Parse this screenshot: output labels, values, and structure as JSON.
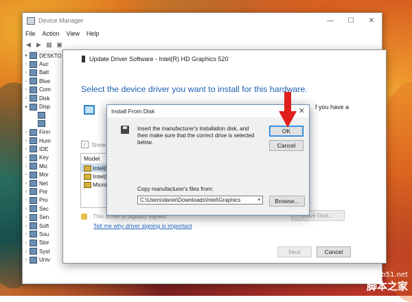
{
  "device_manager": {
    "title": "Device Manager",
    "menu": [
      "File",
      "Action",
      "View",
      "Help"
    ],
    "tree_items": [
      {
        "label": "DESKTO",
        "expanded": true,
        "depth": 0
      },
      {
        "label": "Auc",
        "depth": 1
      },
      {
        "label": "Batt",
        "depth": 1
      },
      {
        "label": "Blue",
        "depth": 1
      },
      {
        "label": "Com",
        "depth": 1
      },
      {
        "label": "Disk",
        "depth": 1
      },
      {
        "label": "Disp",
        "expanded": true,
        "depth": 1
      },
      {
        "label": "",
        "depth": 2
      },
      {
        "label": "",
        "depth": 2
      },
      {
        "label": "Firm",
        "depth": 1
      },
      {
        "label": "Hum",
        "depth": 1
      },
      {
        "label": "IDE",
        "depth": 1
      },
      {
        "label": "Key",
        "depth": 1
      },
      {
        "label": "Mic",
        "depth": 1
      },
      {
        "label": "Mor",
        "depth": 1
      },
      {
        "label": "Net",
        "depth": 1
      },
      {
        "label": "Prir",
        "depth": 1
      },
      {
        "label": "Pro",
        "depth": 1
      },
      {
        "label": "Sec",
        "depth": 1
      },
      {
        "label": "Sen",
        "depth": 1
      },
      {
        "label": "Soft",
        "depth": 1
      },
      {
        "label": "Sou",
        "depth": 1
      },
      {
        "label": "Stor",
        "depth": 1
      },
      {
        "label": "Syst",
        "depth": 1
      },
      {
        "label": "Univ",
        "depth": 1
      }
    ]
  },
  "wizard": {
    "title": "Update Driver Software - Intel(R) HD Graphics 520",
    "heading": "Select the device driver you want to install for this hardware.",
    "side_text": "f you have a",
    "show_compatible": "Show c",
    "model_header": "Model",
    "models": [
      "Intel(R",
      "Intel(R",
      "Micro"
    ],
    "signing_status": "This driver is digitally signed.",
    "signing_link": "Tell me why driver signing is important",
    "have_disk_label": "Have Disk...",
    "next_label": "Next",
    "cancel_label": "Cancel"
  },
  "install_from_disk": {
    "title": "Install From Disk",
    "close": "✕",
    "message": "Insert the manufacturer's installation disk, and then make sure that the correct drive is selected below.",
    "ok_label": "OK",
    "cancel_label": "Cancel",
    "copy_label": "Copy manufacturer's files from:",
    "path": "C:\\Users\\danie\\Downloads\\Intel\\Graphics",
    "browse_label": "Browse..."
  },
  "watermark": {
    "site": "jb51.net",
    "brand": "脚本之家"
  },
  "colors": {
    "accent_blue": "#1d5fb0",
    "arrow_red": "#e0201c"
  }
}
